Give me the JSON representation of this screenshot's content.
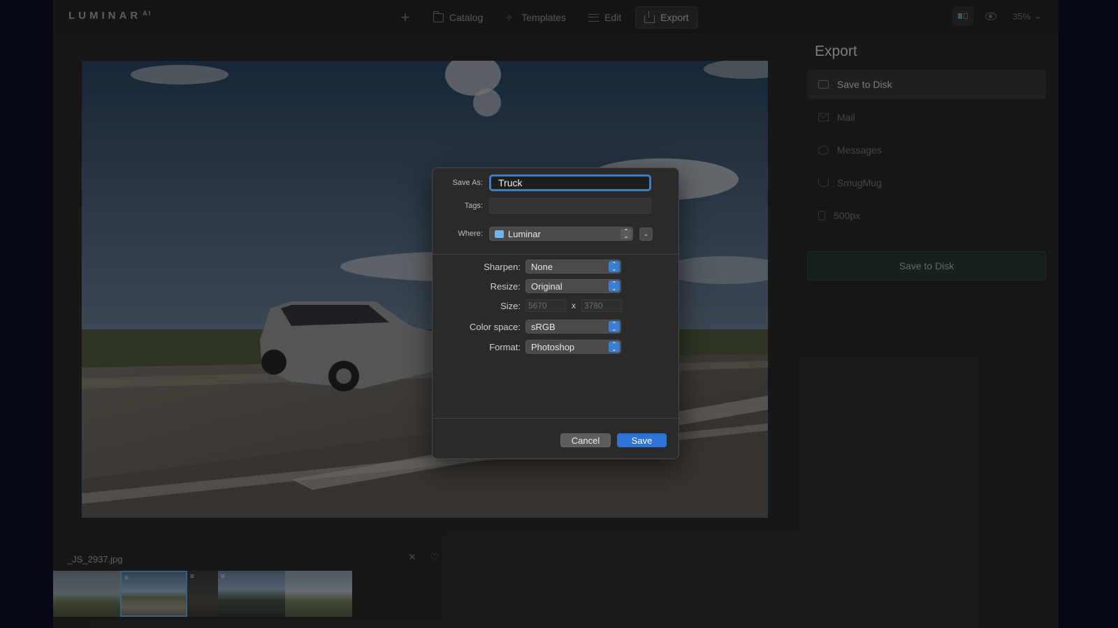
{
  "app": {
    "logo": "LUMINAR",
    "logo_sup": "AI"
  },
  "nav": {
    "items": [
      {
        "label": "Catalog",
        "icon": "folder-icon"
      },
      {
        "label": "Templates",
        "icon": "magic-wand-icon"
      },
      {
        "label": "Edit",
        "icon": "sliders-icon"
      },
      {
        "label": "Export",
        "icon": "share-icon",
        "active": true
      }
    ],
    "zoom": "35%"
  },
  "filmstrip": {
    "filename": "_JS_2937.jpg"
  },
  "panel": {
    "title": "Export",
    "items": [
      {
        "label": "Save to Disk",
        "icon": "folder-icon",
        "active": true
      },
      {
        "label": "Mail",
        "icon": "mail-icon"
      },
      {
        "label": "Messages",
        "icon": "messages-icon"
      },
      {
        "label": "SmugMug",
        "icon": "smugmug-icon"
      },
      {
        "label": "500px",
        "icon": "500px-icon"
      }
    ],
    "save_button": "Save to Disk"
  },
  "dialog": {
    "save_as_label": "Save As:",
    "save_as_value": "Truck",
    "tags_label": "Tags:",
    "tags_value": "",
    "where_label": "Where:",
    "where_value": "Luminar",
    "sharpen_label": "Sharpen:",
    "sharpen_value": "None",
    "resize_label": "Resize:",
    "resize_value": "Original",
    "size_label": "Size:",
    "size_width": "5670",
    "size_x": "x",
    "size_height": "3780",
    "colorspace_label": "Color space:",
    "colorspace_value": "sRGB",
    "format_label": "Format:",
    "format_value": "Photoshop",
    "cancel_label": "Cancel",
    "save_label": "Save"
  }
}
